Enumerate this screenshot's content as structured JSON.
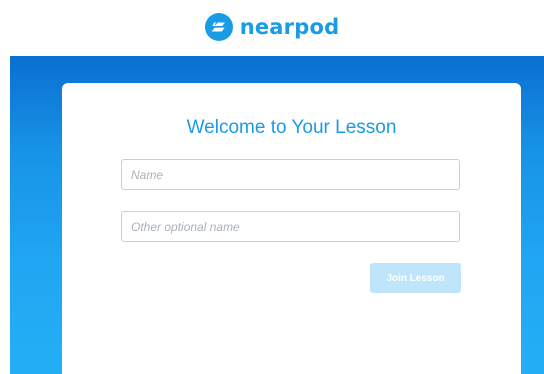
{
  "header": {
    "brand_name": "nearpod",
    "logo_icon": "nearpod-logo-icon",
    "brand_color": "#1a9be6"
  },
  "form": {
    "title": "Welcome to Your Lesson",
    "name_field": {
      "value": "",
      "placeholder": "Name"
    },
    "other_name_field": {
      "value": "",
      "placeholder": "Other optional name"
    },
    "join_button_label": "Join Lesson",
    "join_button_color": "#bfe5fb"
  },
  "colors": {
    "background_gradient_top": "#0a6fd1",
    "background_gradient_bottom": "#24aff5",
    "card": "#ffffff"
  }
}
